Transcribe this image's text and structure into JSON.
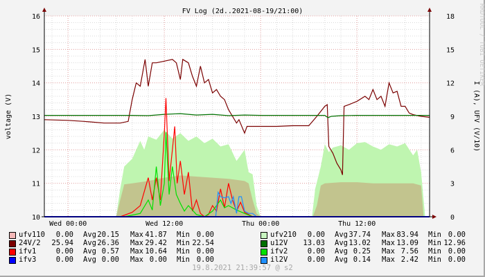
{
  "chart_data": {
    "type": "area",
    "title": "FV Log (2d..2021-08-19/21:00)",
    "ylabel": "voltage (V)",
    "y2label": "I (A), UFV (V/10)",
    "watermark": "RRDTOOL / TOBI OETIKER",
    "xlabel": "",
    "x_unit": "hours from Wed 00:00",
    "xlim": [
      -2.95,
      45.05
    ],
    "ylim": [
      10,
      16
    ],
    "y2lim": [
      0,
      18
    ],
    "grid": true,
    "xticks": [
      {
        "x": 0,
        "label": "Wed 00:00"
      },
      {
        "x": 12,
        "label": "Wed 12:00"
      },
      {
        "x": 24,
        "label": "Thu 00:00"
      },
      {
        "x": 36,
        "label": "Thu 12:00"
      }
    ],
    "yticks": [
      "10",
      "11",
      "12",
      "13",
      "14",
      "15",
      "16"
    ],
    "y2ticks": [
      "0",
      "3",
      "6",
      "9",
      "12",
      "15",
      "18"
    ],
    "series": [
      {
        "name": "ufv210",
        "kind": "area",
        "axis": "right",
        "color": "#bff5b0",
        "x": [
          -2.95,
          6,
          6.5,
          7,
          8,
          9,
          9.5,
          10,
          11,
          12,
          13,
          14,
          15,
          16,
          17,
          18,
          19,
          20,
          21,
          22,
          22.5,
          23,
          23.5,
          24,
          30.4,
          30.8,
          31.5,
          32,
          32.5,
          33,
          34,
          35,
          36,
          37,
          38,
          39,
          40,
          41,
          42,
          43,
          43.5,
          44,
          44.5,
          45.05
        ],
        "y": [
          0,
          0,
          2.5,
          4.5,
          5.2,
          6.8,
          6.0,
          7.2,
          6.9,
          7.8,
          7.0,
          7.5,
          6.8,
          7.2,
          6.6,
          7.0,
          6.3,
          6.5,
          5.0,
          6.0,
          4.0,
          3.8,
          1.0,
          0,
          0,
          2.5,
          4.5,
          6.5,
          5.8,
          6.2,
          6.4,
          6.0,
          6.6,
          6.7,
          6.3,
          6.0,
          6.5,
          6.3,
          6.6,
          5.5,
          6.0,
          4.0,
          0,
          0
        ]
      },
      {
        "name": "ufv110",
        "kind": "area",
        "axis": "right",
        "color": "#c2c48e",
        "x": [
          -2.95,
          6,
          6.5,
          7,
          8,
          10,
          12,
          14,
          16,
          18,
          20,
          21,
          22,
          22.5,
          23,
          23.5,
          24,
          30.5,
          31,
          31.5,
          32,
          34,
          36,
          38,
          40,
          42,
          43,
          44,
          44.3,
          45.05
        ],
        "y": [
          0,
          0,
          1.5,
          2.9,
          3.0,
          3.2,
          3.5,
          3.7,
          3.6,
          3.5,
          3.4,
          3.3,
          3.2,
          3.0,
          1.5,
          0.3,
          0,
          0,
          1.0,
          2.8,
          3.0,
          3.1,
          3.1,
          3.0,
          3.0,
          3.0,
          3.0,
          2.8,
          0,
          0
        ]
      },
      {
        "name": "24V/2",
        "kind": "line",
        "axis": "left",
        "color": "#7a0000",
        "x": [
          -2.95,
          0,
          2,
          4.5,
          6.5,
          7.5,
          8,
          8.5,
          9,
          9.6,
          9.8,
          10,
          10.5,
          11,
          12,
          13,
          13.5,
          14,
          14.3,
          15,
          15.5,
          16,
          16.5,
          17,
          17.5,
          18,
          18.5,
          19,
          19.5,
          20,
          20.5,
          21,
          21.3,
          22,
          22.3,
          23,
          24,
          26,
          28,
          30,
          31,
          32,
          32.3,
          32.5,
          33,
          33.5,
          34,
          34.2,
          34.4,
          35,
          36,
          37,
          37.5,
          38,
          38.5,
          39,
          39.5,
          40,
          40.5,
          41,
          41.5,
          42,
          42.5,
          43,
          44,
          45.05
        ],
        "y": [
          12.9,
          12.88,
          12.85,
          12.8,
          12.8,
          12.85,
          13.5,
          14.0,
          13.9,
          14.7,
          14.3,
          13.9,
          14.6,
          14.6,
          14.65,
          14.7,
          14.6,
          14.1,
          14.7,
          14.6,
          14.2,
          13.9,
          14.5,
          14.0,
          14.1,
          13.7,
          13.8,
          13.6,
          13.5,
          13.2,
          13.0,
          12.8,
          12.9,
          12.5,
          12.7,
          12.7,
          12.7,
          12.7,
          12.72,
          12.72,
          13.0,
          13.3,
          13.35,
          12.1,
          11.9,
          11.6,
          11.4,
          11.25,
          13.3,
          13.35,
          13.45,
          13.6,
          13.5,
          13.8,
          13.5,
          13.6,
          13.3,
          14.0,
          13.7,
          13.75,
          13.3,
          13.3,
          13.1,
          13.05,
          13.0,
          12.97
        ]
      },
      {
        "name": "u12V",
        "kind": "line",
        "axis": "left",
        "color": "#007000",
        "x": [
          -2.95,
          8,
          10,
          12,
          14,
          16,
          18,
          20,
          22,
          24,
          30,
          32,
          32.4,
          32.8,
          34,
          36,
          40,
          45.05
        ],
        "y": [
          13.03,
          13.03,
          13.02,
          13.06,
          13.08,
          13.04,
          13.06,
          13.02,
          13.04,
          13.03,
          13.03,
          13.03,
          12.96,
          13.0,
          13.02,
          13.03,
          13.03,
          13.03
        ]
      },
      {
        "name": "ifv1",
        "kind": "line",
        "axis": "right",
        "color": "#ff0000",
        "x": [
          -2.95,
          6.5,
          8,
          9,
          10,
          10.5,
          11,
          11.5,
          12,
          12.2,
          12.6,
          13,
          13.3,
          13.6,
          14,
          14.5,
          15,
          15.5,
          16,
          16.5,
          17,
          17.5,
          18,
          18.5,
          19,
          19.5,
          20,
          20.5,
          21,
          21.5,
          22,
          22.5,
          23,
          45.05
        ],
        "y": [
          0,
          0,
          0.4,
          1.0,
          3.5,
          1.5,
          3.5,
          1.5,
          7.5,
          10.64,
          3.2,
          6.0,
          8.1,
          3.0,
          5.0,
          2.0,
          4.0,
          0.5,
          1.5,
          0.3,
          0,
          0.2,
          1.0,
          0.5,
          2.5,
          0.8,
          3.0,
          1.5,
          0.5,
          1.3,
          0.4,
          0.2,
          0,
          0
        ]
      },
      {
        "name": "ifv2",
        "kind": "line",
        "axis": "right",
        "color": "#00e000",
        "x": [
          -2.95,
          7,
          9,
          10,
          10.5,
          11,
          11.5,
          12,
          12.2,
          12.6,
          13,
          13.5,
          14,
          14.5,
          15,
          16,
          17,
          18,
          19,
          19.5,
          20,
          21,
          22,
          23,
          45.05
        ],
        "y": [
          0,
          0,
          0.3,
          1.5,
          0.6,
          4.5,
          1.0,
          3.0,
          7.56,
          2.0,
          4.5,
          2.0,
          1.2,
          0.5,
          1.0,
          0.2,
          0,
          0.5,
          1.5,
          0.8,
          1.0,
          0.6,
          0.3,
          0,
          0
        ]
      },
      {
        "name": "il2V",
        "kind": "line",
        "axis": "right",
        "color": "#1e90ff",
        "x": [
          -2.95,
          18.4,
          18.7,
          19,
          19.5,
          20,
          20.3,
          20.6,
          21,
          21.3,
          21.6,
          22,
          22.5,
          23,
          23.5,
          45.05
        ],
        "y": [
          0,
          0,
          2.2,
          1.8,
          1.7,
          1.8,
          1.2,
          1.8,
          0.3,
          1.8,
          1.8,
          0.5,
          0.3,
          0.3,
          0,
          0
        ]
      },
      {
        "name": "ifv3",
        "kind": "line",
        "axis": "right",
        "color": "#0000ff",
        "x": [
          -2.95,
          45.05
        ],
        "y": [
          0,
          0
        ]
      }
    ]
  },
  "legend": [
    {
      "name": "ufv110",
      "color": "#f4b8b8",
      "cur": "0.00",
      "avg": "20.15",
      "max": "41.87",
      "min": "0.00"
    },
    {
      "name": "24V/2",
      "color": "#7a0000",
      "cur": "25.94",
      "avg": "26.36",
      "max": "29.42",
      "min": "22.54"
    },
    {
      "name": "ifv1",
      "color": "#ff0000",
      "cur": "0.00",
      "avg": "0.57",
      "max": "10.64",
      "min": "0.00"
    },
    {
      "name": "ifv3",
      "color": "#0000ff",
      "cur": "0.00",
      "avg": "0.00",
      "max": "0.00",
      "min": "0.00"
    },
    {
      "name": "ufv210",
      "color": "#c8f5c0",
      "cur": "0.00",
      "avg": "37.74",
      "max": "83.94",
      "min": "0.00"
    },
    {
      "name": "u12V",
      "color": "#007000",
      "cur": "13.03",
      "avg": "13.02",
      "max": "13.09",
      "min": "12.96"
    },
    {
      "name": "ifv2",
      "color": "#00e000",
      "cur": "0.00",
      "avg": "0.25",
      "max": "7.56",
      "min": "0.00"
    },
    {
      "name": "il2V",
      "color": "#1e90ff",
      "cur": "0.00",
      "avg": "0.14",
      "max": "2.42",
      "min": "0.00"
    }
  ],
  "legend_labels": {
    "avg": "Avg",
    "max": "Max",
    "min": "Min"
  },
  "timestamp": "19.8.2021 21:39:57 @ s2"
}
